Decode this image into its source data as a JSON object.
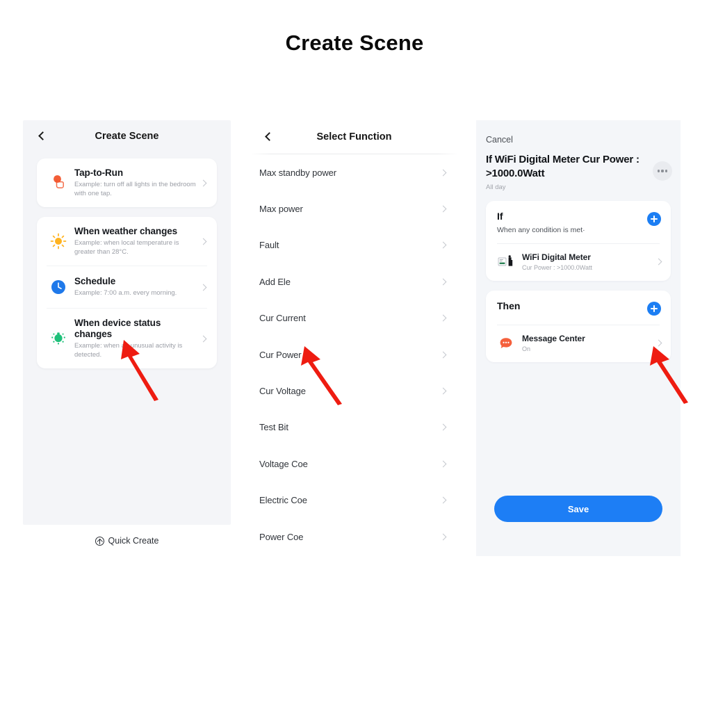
{
  "page": {
    "title": "Create Scene"
  },
  "panel_create_scene": {
    "nav": {
      "back_icon": "chevron-left-icon",
      "title": "Create Scene"
    },
    "cards": [
      {
        "rows": [
          {
            "icon": "tap-to-run-icon",
            "title": "Tap-to-Run",
            "subtitle": "Example: turn off all lights in the bedroom with one tap.",
            "chevron": "chevron-right-icon"
          }
        ]
      },
      {
        "rows": [
          {
            "icon": "weather-sun-icon",
            "title": "When weather changes",
            "subtitle": "Example: when local temperature is greater than 28°C.",
            "chevron": "chevron-right-icon"
          },
          {
            "icon": "schedule-clock-icon",
            "title": "Schedule",
            "subtitle": "Example: 7:00 a.m. every morning.",
            "chevron": "chevron-right-icon"
          },
          {
            "icon": "device-status-icon",
            "title": "When device status changes",
            "subtitle": "Example: when an unusual activity is detected.",
            "chevron": "chevron-right-icon"
          }
        ]
      }
    ],
    "quick_create": {
      "icon": "arrow-up-circle-icon",
      "label": "Quick Create"
    }
  },
  "panel_select_function": {
    "nav": {
      "back_icon": "chevron-left-icon",
      "title": "Select Function"
    },
    "items": [
      {
        "label": "Max standby power",
        "chevron": "chevron-right-icon"
      },
      {
        "label": "Max power",
        "chevron": "chevron-right-icon"
      },
      {
        "label": "Fault",
        "chevron": "chevron-right-icon"
      },
      {
        "label": "Add Ele",
        "chevron": "chevron-right-icon"
      },
      {
        "label": "Cur Current",
        "chevron": "chevron-right-icon"
      },
      {
        "label": "Cur Power",
        "chevron": "chevron-right-icon"
      },
      {
        "label": "Cur Voltage",
        "chevron": "chevron-right-icon"
      },
      {
        "label": "Test Bit",
        "chevron": "chevron-right-icon"
      },
      {
        "label": "Voltage Coe",
        "chevron": "chevron-right-icon"
      },
      {
        "label": "Electric Coe",
        "chevron": "chevron-right-icon"
      },
      {
        "label": "Power Coe",
        "chevron": "chevron-right-icon"
      }
    ]
  },
  "panel_scene_editor": {
    "cancel_label": "Cancel",
    "scene_title": "If WiFi Digital Meter Cur Power : >1000.0Watt",
    "scene_subtitle": "All day",
    "more_icon": "ellipsis-icon",
    "if_card": {
      "heading": "If",
      "condition_mode": "When any condition is met·",
      "add_icon": "plus-circle-icon",
      "item": {
        "icon": "wifi-digital-meter-icon",
        "title": "WiFi Digital Meter",
        "subtitle": "Cur Power : >1000.0Watt",
        "chevron": "chevron-right-icon"
      }
    },
    "then_card": {
      "heading": "Then",
      "add_icon": "plus-circle-icon",
      "item": {
        "icon": "message-center-icon",
        "title": "Message Center",
        "subtitle": "On",
        "chevron": "chevron-right-icon"
      }
    },
    "save_label": "Save"
  },
  "annotations": {
    "arrows": [
      {
        "name": "arrow-device-status"
      },
      {
        "name": "arrow-cur-power"
      },
      {
        "name": "arrow-then-add"
      }
    ],
    "color": "#ee1c11"
  },
  "colors": {
    "accent_blue": "#1d7ef5",
    "arrow_red": "#ee1c11",
    "panel_bg": "#f4f6f9",
    "card_bg": "#ffffff"
  }
}
